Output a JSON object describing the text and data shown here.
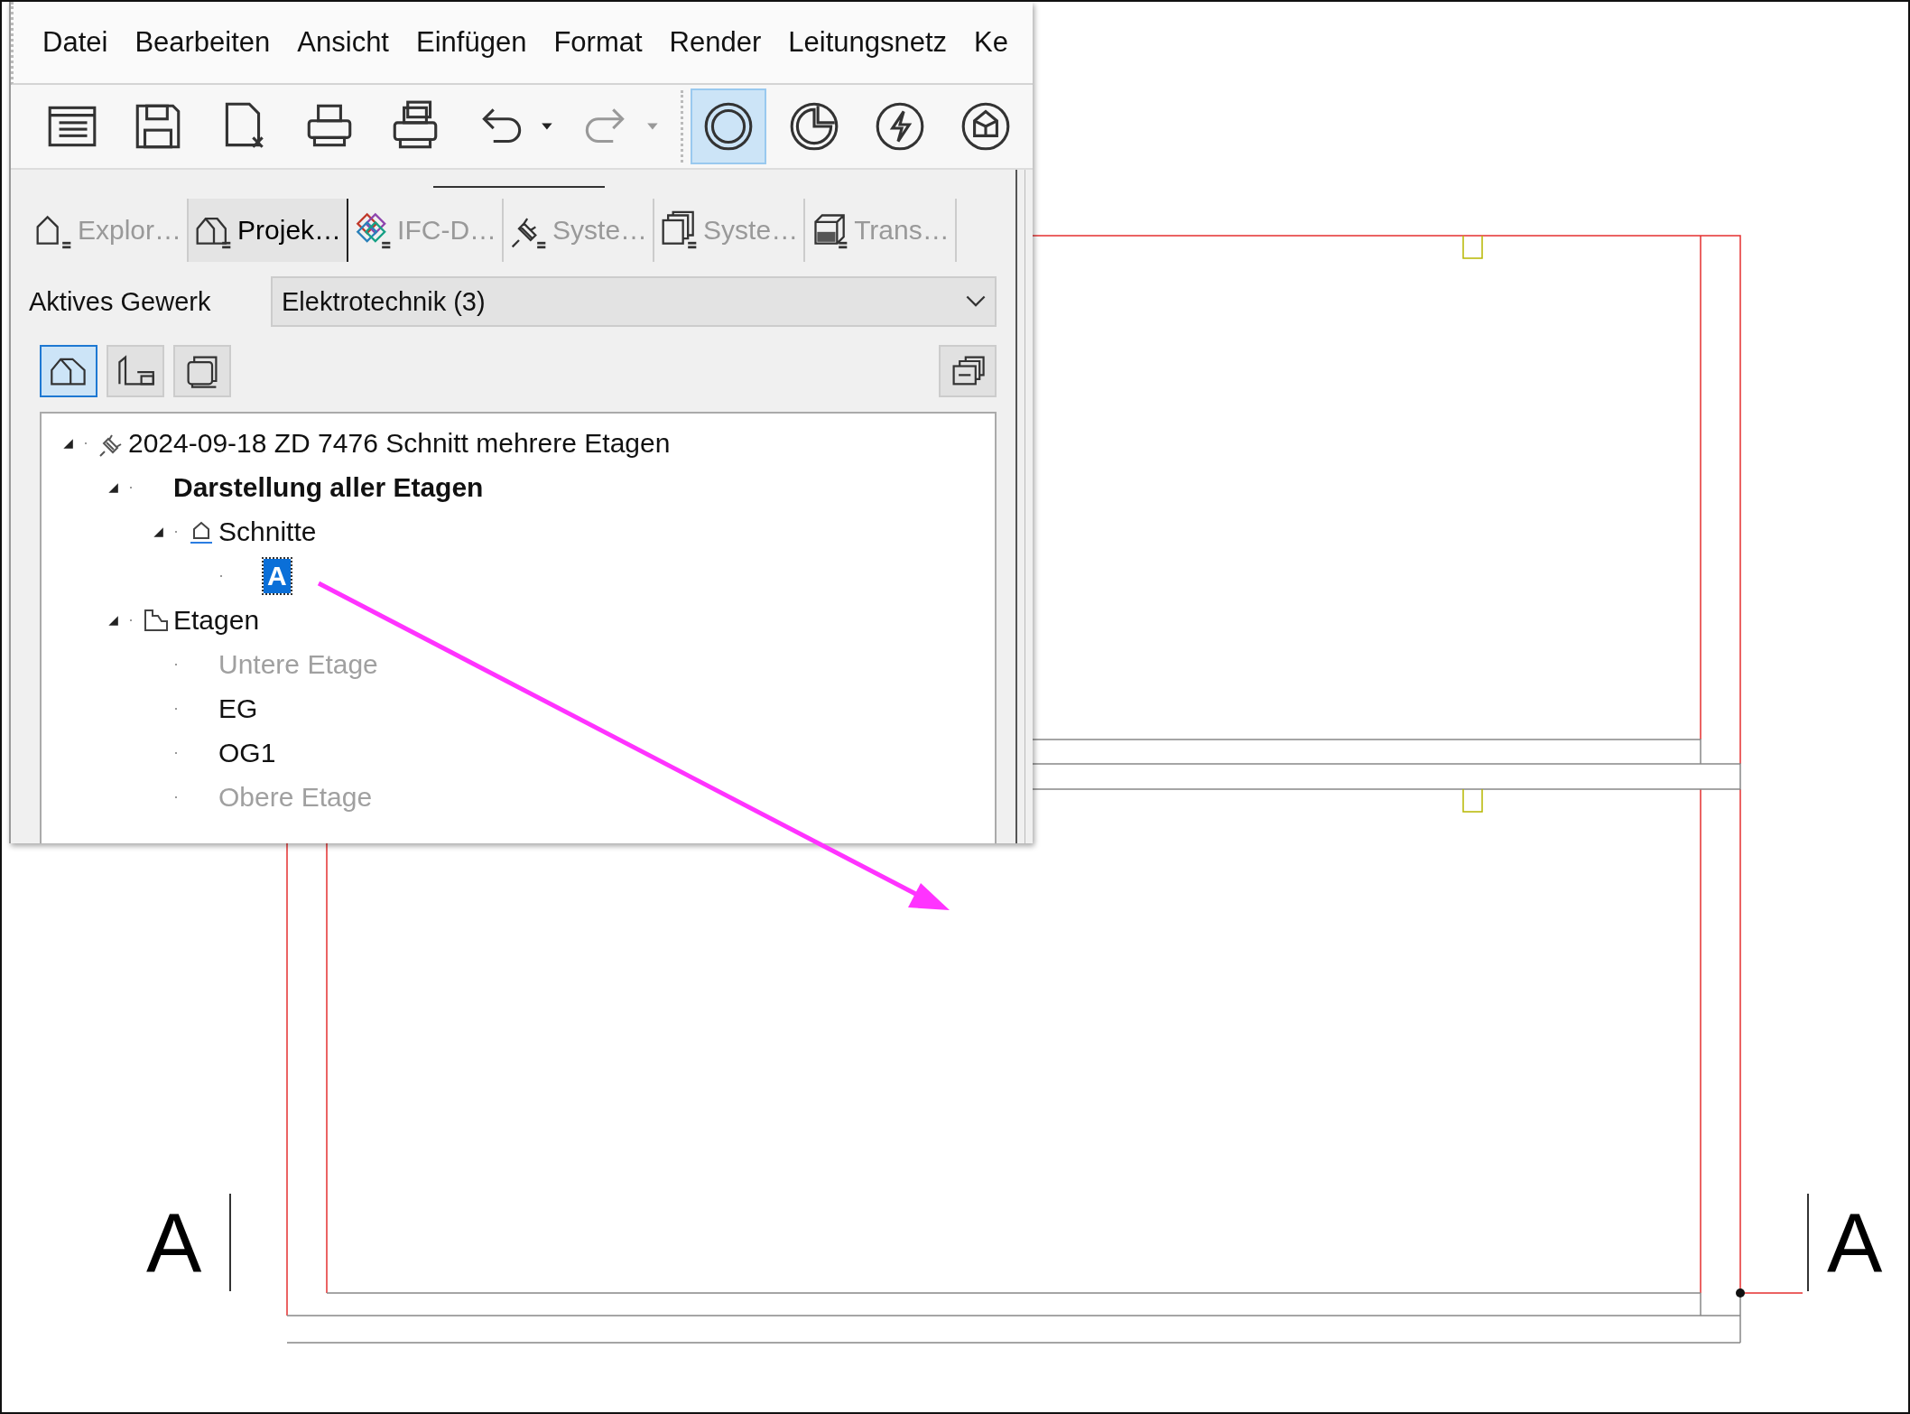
{
  "menu": [
    "Datei",
    "Bearbeiten",
    "Ansicht",
    "Einfügen",
    "Format",
    "Render",
    "Leitungsnetz",
    "Ke"
  ],
  "toolbar": [
    {
      "kind": "panel",
      "selected": false
    },
    {
      "kind": "save",
      "selected": false
    },
    {
      "kind": "close-file",
      "selected": false
    },
    {
      "kind": "print",
      "selected": false
    },
    {
      "kind": "print-setup",
      "selected": false
    },
    {
      "kind": "undo",
      "selected": false
    },
    {
      "kind": "redo",
      "selected": false,
      "disabled": true
    },
    {
      "kind": "ring",
      "selected": true
    },
    {
      "kind": "pie",
      "selected": false
    },
    {
      "kind": "bolt",
      "selected": false
    },
    {
      "kind": "cube",
      "selected": false
    }
  ],
  "tabs": [
    {
      "label": "Explor…",
      "kind": "house",
      "selected": false
    },
    {
      "label": "Projek…",
      "kind": "building",
      "selected": true
    },
    {
      "label": "IFC-D…",
      "kind": "links",
      "selected": false
    },
    {
      "label": "Syste…",
      "kind": "plug",
      "selected": false
    },
    {
      "label": "Syste…",
      "kind": "stack",
      "selected": false
    },
    {
      "label": "Trans…",
      "kind": "cube",
      "selected": false
    }
  ],
  "gewerk": {
    "label": "Aktives Gewerk",
    "value": "Elektrotechnik (3)"
  },
  "view_buttons": [
    {
      "kind": "building",
      "selected": true
    },
    {
      "kind": "floor",
      "selected": false
    },
    {
      "kind": "layers",
      "selected": false
    }
  ],
  "tree": [
    {
      "label": "2024-09-18 ZD 7476 Schnitt mehrere Etagen",
      "kind": "plug",
      "expanded": true,
      "children": [
        {
          "label": "Darstellung aller Etagen",
          "bold": true,
          "kind": "group",
          "expanded": true,
          "children": [
            {
              "label": "Schnitte",
              "kind": "section",
              "expanded": true,
              "children": [
                {
                  "label": "A",
                  "selected": true
                }
              ]
            }
          ]
        },
        {
          "label": "Etagen",
          "kind": "folder",
          "expanded": true,
          "children": [
            {
              "label": "Untere Etage",
              "disabled": true
            },
            {
              "label": "EG",
              "disabled": false
            },
            {
              "label": "OG1",
              "disabled": false
            },
            {
              "label": "Obere Etage",
              "disabled": true
            }
          ]
        }
      ]
    }
  ],
  "section_markers": [
    "A",
    "A"
  ]
}
